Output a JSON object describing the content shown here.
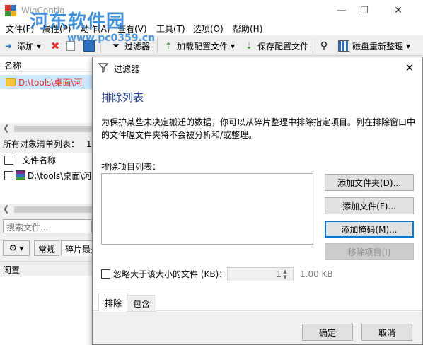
{
  "app": {
    "title": "WinContig",
    "watermark": "河东软件园",
    "watermark_url": "www.pc0359.cn"
  },
  "window_controls": {
    "minimize": "—",
    "maximize": "☐",
    "close": "✕"
  },
  "menu": [
    "文件(F)",
    "属性(P)",
    "动作(A)",
    "查看(V)",
    "工具(T)",
    "选项(O)",
    "帮助(H)"
  ],
  "toolbar": {
    "add": "添加",
    "filter": "过滤器",
    "load_config": "加载配置文件",
    "save_config": "保存配置文件",
    "defrag": "磁盘重新整理"
  },
  "left_panel": {
    "list_header": "名称",
    "selected_path": "D:\\tools\\桌面\\河",
    "all_objects_label": "所有对象清单列表：",
    "all_objects_count": "1",
    "file_name_header": "文件名称",
    "file_row_path": "D:\\tools\\桌面\\河",
    "search_placeholder": "搜索文件...",
    "tab_general": "常规",
    "tab_frag": "碎片最多",
    "status": "闲置"
  },
  "dialog": {
    "title": "过滤器",
    "close": "✕",
    "heading": "排除列表",
    "description": "为保护某些未决定搬迁的数据，你可以从碎片整理中排除指定项目。列在排除窗口中的文件喔文件夹将不会被分析和/或整理。",
    "exclusion_list_label": "排除项目列表：",
    "buttons": {
      "add_folder": "添加文件夹(D)...",
      "add_file": "添加文件(F)...",
      "add_mask": "添加掩码(M)...",
      "remove_item": "移除项目(I)"
    },
    "ignore_label": "忽略大于该大小的文件 (KB)：",
    "size_value": "1",
    "size_hint": "1.00 KB",
    "tabs": [
      "排除",
      "包含"
    ],
    "ok": "确定",
    "cancel": "取消"
  }
}
